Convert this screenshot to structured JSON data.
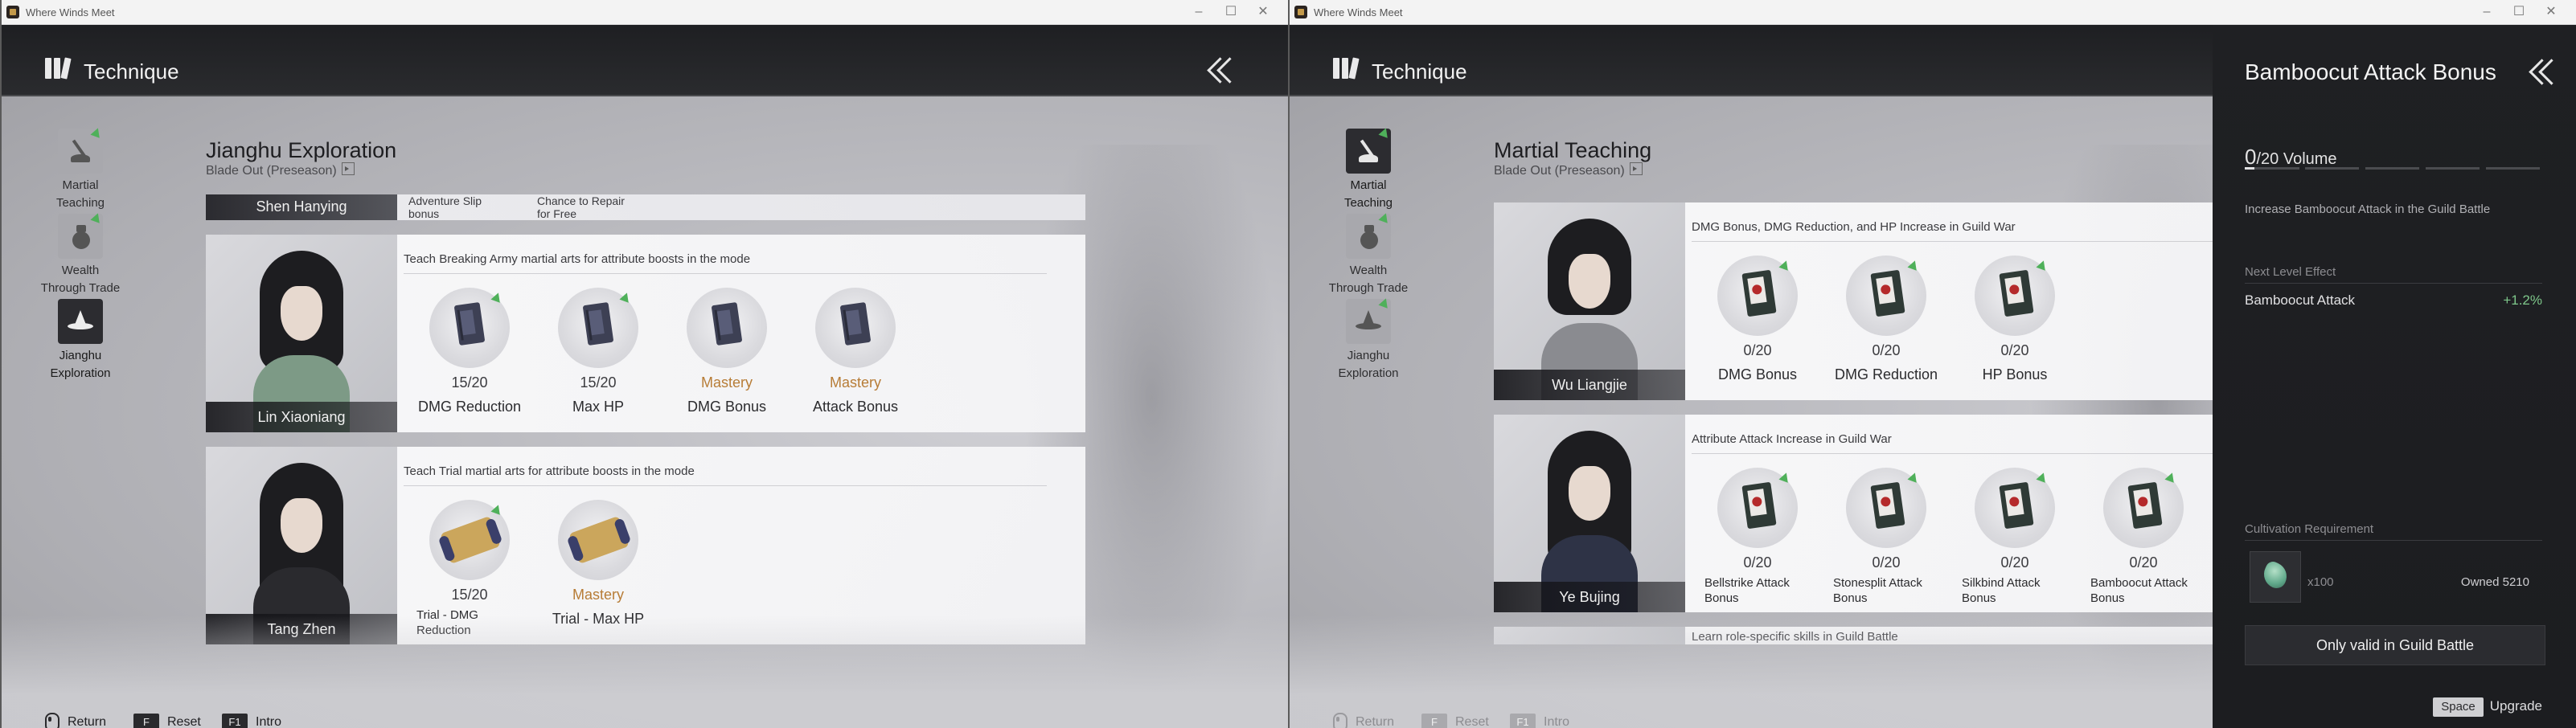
{
  "window": {
    "title": "Where Winds Meet"
  },
  "header": {
    "title": "Technique"
  },
  "nav": [
    {
      "label_l1": "Martial",
      "label_l2": "Teaching"
    },
    {
      "label_l1": "Wealth",
      "label_l2": "Through Trade"
    },
    {
      "label_l1": "Jianghu",
      "label_l2": "Exploration"
    }
  ],
  "left": {
    "section_title": "Jianghu Exploration",
    "section_sub": "Blade Out (Preseason)",
    "partial_card": {
      "name": "Shen Hanying",
      "skill1_l1": "Adventure Slip",
      "skill1_l2": "bonus",
      "skill2_l1": "Chance to Repair",
      "skill2_l2": "for Free"
    },
    "cards": [
      {
        "name": "Lin Xiaoniang",
        "desc": "Teach Breaking Army martial arts for attribute boosts in the mode",
        "skills": [
          {
            "count": "15/20",
            "name": "DMG Reduction"
          },
          {
            "count": "15/20",
            "name": "Max HP"
          },
          {
            "count": "Mastery",
            "name": "DMG Bonus"
          },
          {
            "count": "Mastery",
            "name": "Attack Bonus"
          }
        ]
      },
      {
        "name": "Tang Zhen",
        "desc": "Teach Trial martial arts for attribute boosts in the mode",
        "skills": [
          {
            "count": "15/20",
            "name_l1": "Trial - DMG",
            "name_l2": "Reduction"
          },
          {
            "count": "Mastery",
            "name": "Trial - Max HP"
          }
        ]
      }
    ],
    "hints": {
      "return": "Return",
      "reset_key": "F",
      "reset": "Reset",
      "intro_key": "F1",
      "intro": "Intro"
    }
  },
  "right": {
    "section_title": "Martial Teaching",
    "section_sub": "Blade Out (Preseason)",
    "cards": [
      {
        "name": "Wu Liangjie",
        "desc": "DMG Bonus, DMG Reduction, and HP Increase in Guild War",
        "skills": [
          {
            "count": "0/20",
            "name": "DMG Bonus"
          },
          {
            "count": "0/20",
            "name": "DMG Reduction"
          },
          {
            "count": "0/20",
            "name": "HP Bonus"
          }
        ]
      },
      {
        "name": "Ye Bujing",
        "desc": "Attribute Attack Increase in Guild War",
        "skills": [
          {
            "count": "0/20",
            "name_l1": "Bellstrike Attack",
            "name_l2": "Bonus"
          },
          {
            "count": "0/20",
            "name_l1": "Stonesplit Attack",
            "name_l2": "Bonus"
          },
          {
            "count": "0/20",
            "name_l1": "Silkbind Attack",
            "name_l2": "Bonus"
          },
          {
            "count": "0/20",
            "name_l1": "Bamboocut Attack",
            "name_l2": "Bonus"
          }
        ]
      }
    ],
    "partial_desc": "Learn role-specific skills in Guild Battle",
    "hints": {
      "return": "Return",
      "reset_key": "F",
      "reset": "Reset",
      "intro_key": "F1",
      "intro": "Intro"
    },
    "panel": {
      "title": "Bamboocut Attack Bonus",
      "volume_current": "0",
      "volume_rest": "/20 Volume",
      "desc": "Increase Bamboocut Attack in the Guild Battle",
      "next_label": "Next Level Effect",
      "effect_name": "Bamboocut Attack",
      "effect_value": "+1.2%",
      "req_label": "Cultivation Requirement",
      "req_qty": "x100",
      "req_owned": "Owned 5210",
      "guild_button": "Only valid in Guild Battle",
      "upgrade_key": "Space",
      "upgrade_label": "Upgrade"
    }
  }
}
